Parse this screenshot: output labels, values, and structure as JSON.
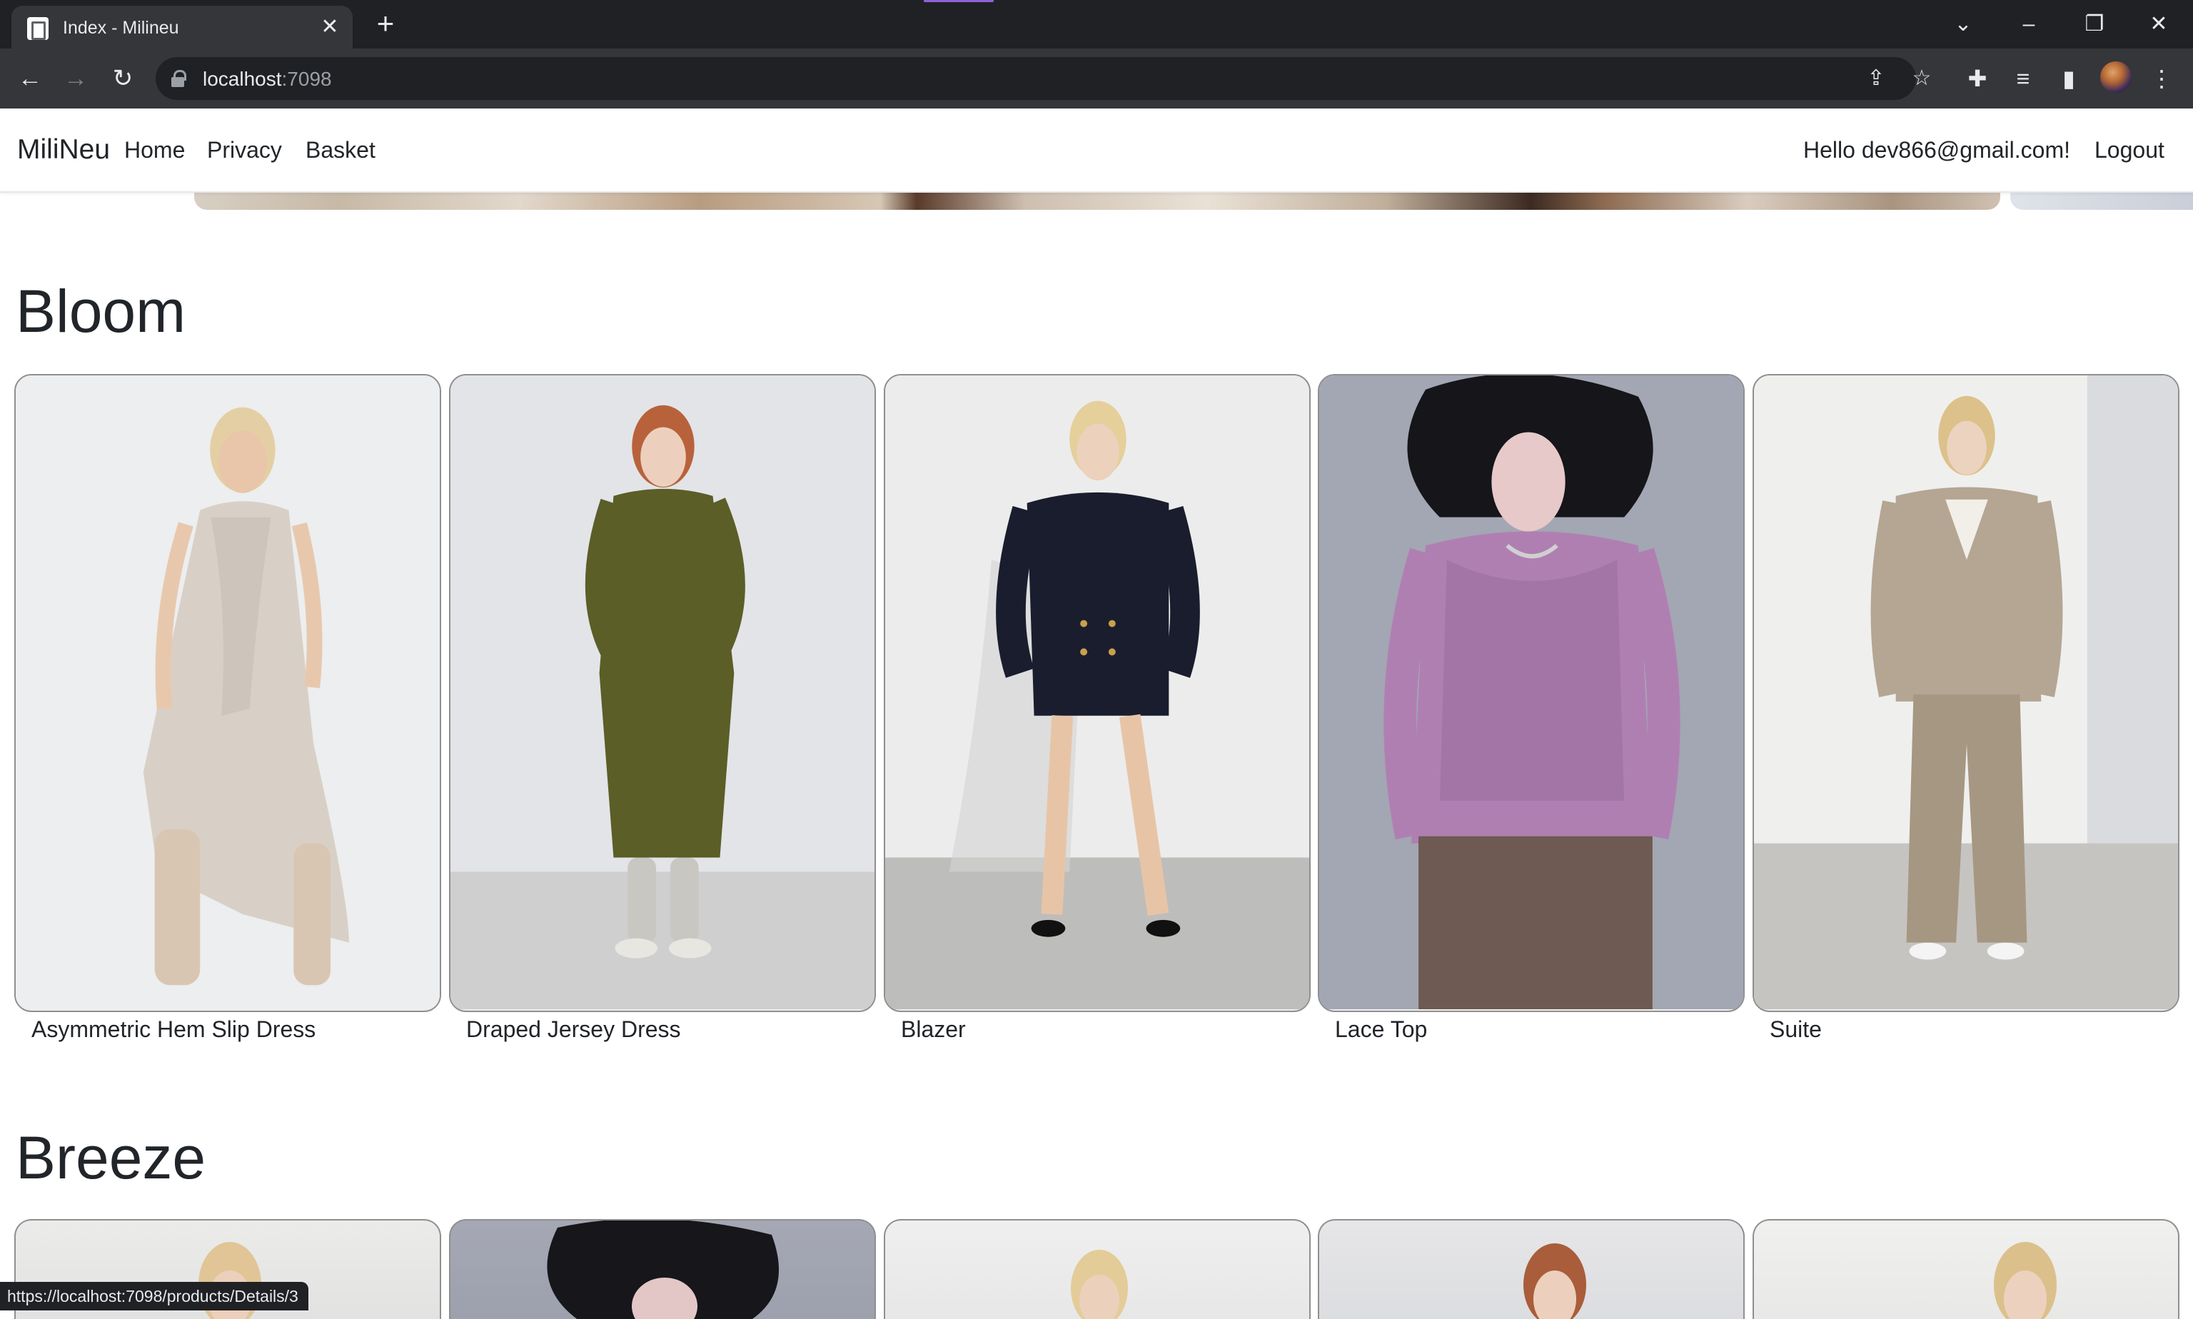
{
  "browser": {
    "tab_title": "Index - Milineu",
    "url_host": "localhost",
    "url_port": ":7098",
    "status_url": "https://localhost:7098/products/Details/3"
  },
  "site": {
    "brand": "MiliNeu",
    "nav": [
      "Home",
      "Privacy",
      "Basket"
    ],
    "greeting": "Hello dev866@gmail.com!",
    "logout": "Logout"
  },
  "sections": [
    {
      "title": "Bloom",
      "products": [
        {
          "name": "Asymmetric Hem Slip Dress"
        },
        {
          "name": "Draped Jersey Dress"
        },
        {
          "name": "Blazer"
        },
        {
          "name": "Lace Top"
        },
        {
          "name": "Suite"
        }
      ]
    },
    {
      "title": "Breeze"
    }
  ],
  "icons": {
    "tab_close": "close-icon",
    "new_tab": "plus-icon",
    "back": "arrow-left-icon",
    "forward": "arrow-right-icon",
    "reload": "reload-icon",
    "share": "share-icon",
    "bookmark": "star-icon",
    "extensions": "puzzle-icon",
    "media": "media-queue-icon",
    "side_panel": "side-panel-icon",
    "menu": "kebab-menu-icon"
  },
  "colors": {
    "chrome_dark": "#202124",
    "chrome_toolbar": "#35363a",
    "text": "#212529"
  }
}
